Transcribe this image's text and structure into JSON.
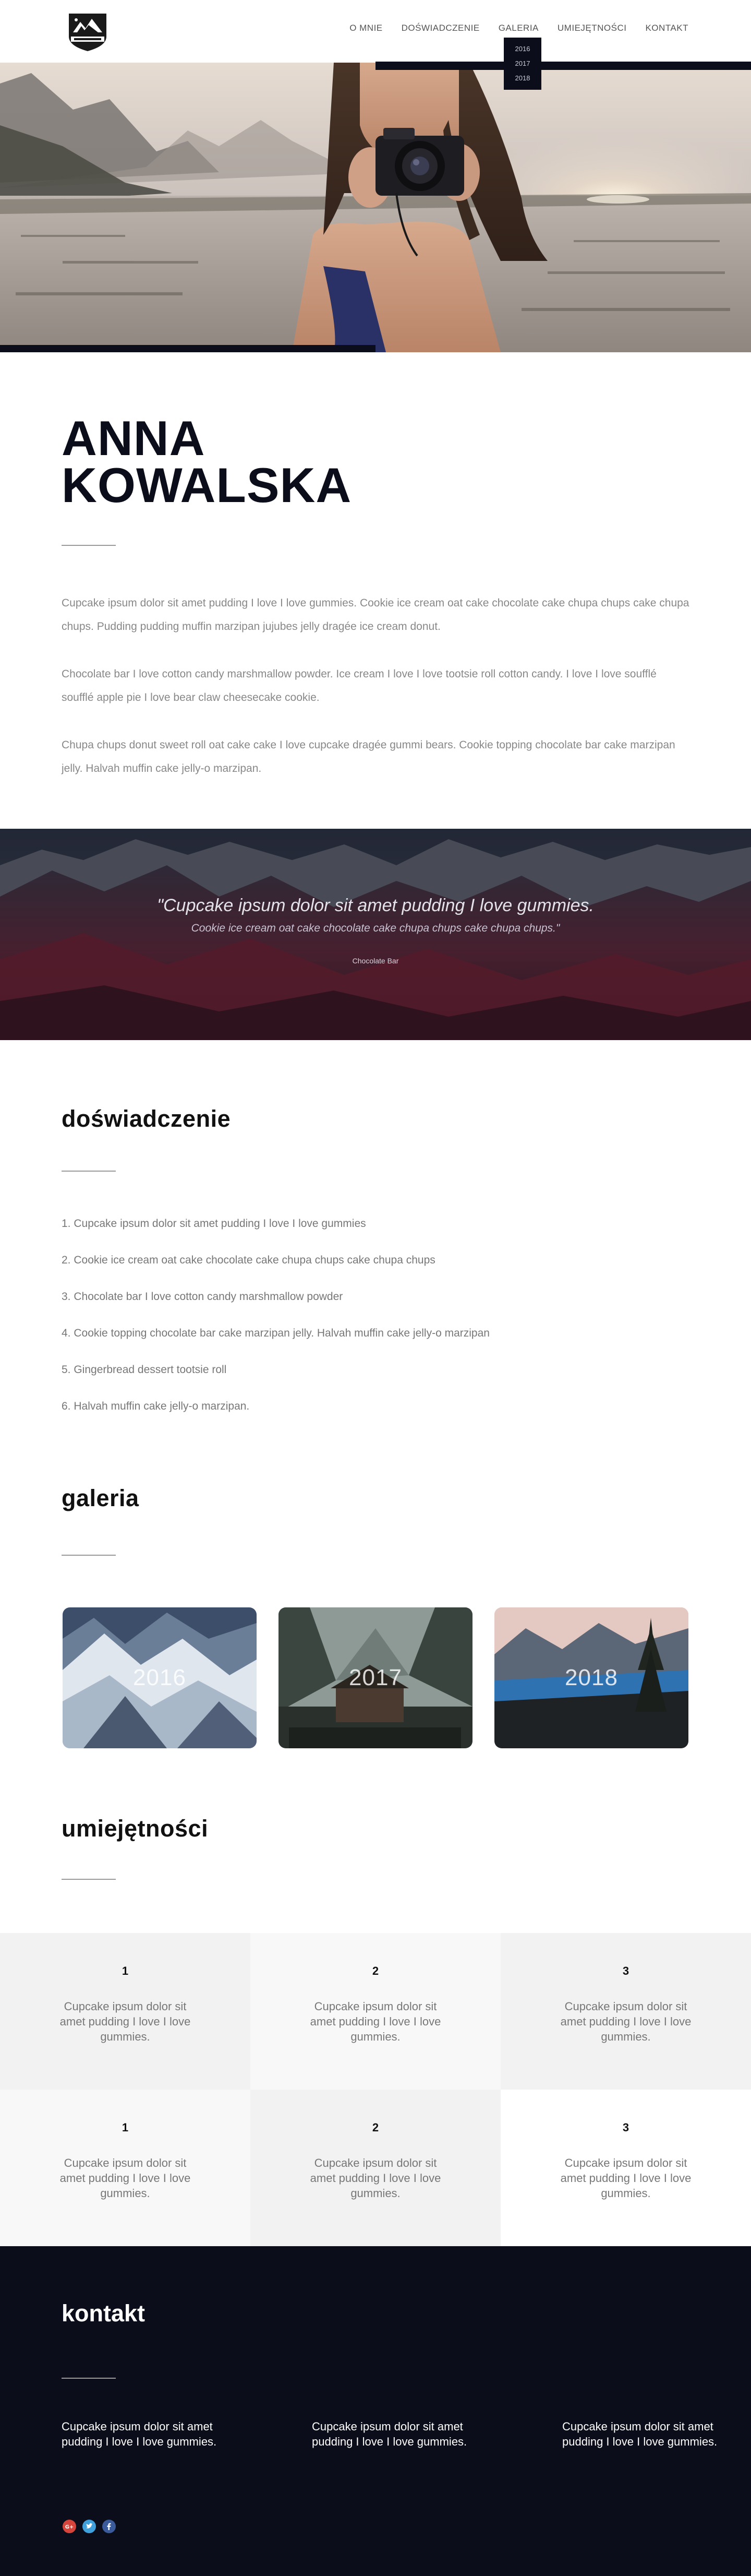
{
  "nav": {
    "items": [
      "O MNIE",
      "DOŚWIADCZENIE",
      "GALERIA",
      "UMIEJĘTNOŚCI",
      "KONTAKT"
    ],
    "gallery_dropdown": [
      "2016",
      "2017",
      "2018"
    ]
  },
  "about": {
    "name_line1": "ANNA",
    "name_line2": "KOWALSKA",
    "paragraph1": "Cupcake ipsum dolor sit amet pudding I love I love gummies. Cookie ice cream oat cake chocolate cake chupa chups cake chupa chups. Pudding pudding muffin marzipan jujubes jelly dragée ice cream donut.",
    "paragraph2": "Chocolate bar I love cotton candy marshmallow powder. Ice cream I love I love tootsie roll cotton candy. I love I love soufflé soufflé apple pie I love bear claw cheesecake cookie.",
    "paragraph3": "Chupa chups donut sweet roll oat cake cake I love cupcake dragée gummi bears. Cookie topping chocolate bar cake marzipan jelly. Halvah muffin cake jelly-o marzipan."
  },
  "quote": {
    "main": "\"Cupcake ipsum dolor sit amet pudding I love gummies.",
    "sub": "Cookie ice cream oat cake chocolate cake chupa chups cake chupa chups.\"",
    "author": "Chocolate Bar"
  },
  "experience": {
    "title": "doświadczenie",
    "items": [
      "1. Cupcake ipsum dolor sit amet pudding I love I love gummies",
      "2. Cookie ice cream oat cake chocolate cake chupa chups cake chupa chups",
      "3. Chocolate bar I love cotton candy marshmallow powder",
      "4. Cookie topping chocolate bar cake marzipan jelly. Halvah muffin cake jelly-o marzipan",
      "5. Gingerbread dessert tootsie roll",
      "6. Halvah muffin cake jelly-o marzipan."
    ]
  },
  "gallery": {
    "title": "galeria",
    "cards": [
      "2016",
      "2017",
      "2018"
    ]
  },
  "skills": {
    "title": "umiejętności",
    "cells": [
      {
        "num": "1",
        "text": "Cupcake ipsum dolor sit amet pudding I love I love gummies."
      },
      {
        "num": "2",
        "text": "Cupcake ipsum dolor sit amet pudding I love I love gummies."
      },
      {
        "num": "3",
        "text": "Cupcake ipsum dolor sit amet pudding I love I love gummies."
      },
      {
        "num": "1",
        "text": "Cupcake ipsum dolor sit amet pudding I love I love gummies."
      },
      {
        "num": "2",
        "text": "Cupcake ipsum dolor sit amet pudding I love I love gummies."
      },
      {
        "num": "3",
        "text": "Cupcake ipsum dolor sit amet pudding I love I love gummies."
      }
    ]
  },
  "contact": {
    "title": "kontakt",
    "columns": [
      "Cupcake ipsum dolor sit amet pudding I love I love gummies.",
      "Cupcake ipsum dolor sit amet pudding I love I love gummies.",
      "Cupcake ipsum dolor sit amet pudding I love I love gummies."
    ],
    "social_icons": [
      "google-plus-icon",
      "twitter-icon",
      "facebook-icon"
    ]
  },
  "colors": {
    "dark": "#0b0e1a",
    "text_muted": "#888888",
    "skill_bg_a": "#f2f2f2",
    "skill_bg_b": "#f8f8f8",
    "google": "#d6453b",
    "twitter": "#3fa0dc",
    "facebook": "#3b5a9a"
  }
}
